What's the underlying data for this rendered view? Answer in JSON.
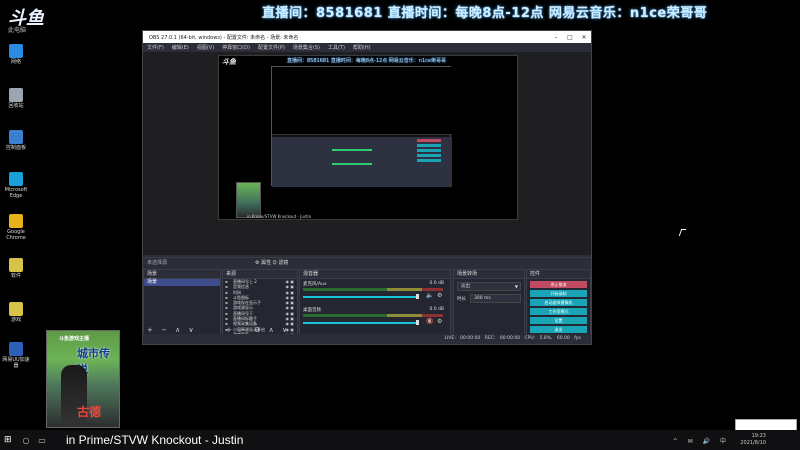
{
  "banner": "直播间：8581681 直播时间：每晚8点-12点 网易云音乐：n1ce荣哥哥",
  "logo": {
    "main": "斗鱼",
    "sub": "此电脑"
  },
  "desktop_icons": [
    {
      "label": "网络",
      "color": "#2b8be0"
    },
    {
      "label": "回收站",
      "color": "#9aa6b2"
    },
    {
      "label": "控制面板",
      "color": "#3a7fd0"
    },
    {
      "label": "Microsoft Edge",
      "color": "#19a0d8"
    },
    {
      "label": "Google Chrome",
      "color": "#e8b21a"
    },
    {
      "label": "软件",
      "color": "#d8c24a"
    },
    {
      "label": "游戏",
      "color": "#d8c24a"
    },
    {
      "label": "网易UU加速器",
      "color": "#2b5fb8"
    }
  ],
  "obs": {
    "title": "OBS 27.0.1 (64-bit, windows) - 配置文件: 未命名 - 场景: 未命名",
    "menu": [
      "文件(F)",
      "编辑(E)",
      "视图(V)",
      "停靠窗口(D)",
      "配置文件(P)",
      "场景集合(S)",
      "工具(T)",
      "帮助(H)"
    ],
    "preview": {
      "mini_banner": "直播间：8581681 直播时间：每晚8点-12点 网易云音乐：n1ce荣哥哥",
      "mini_logo": "斗鱼",
      "bottom_label": "in Prime/STVW  Knockout - Justin"
    },
    "dock_title": "未选择源",
    "dock_controls": "⚙ 属性   ⛭ 滤镜",
    "scenes": {
      "title": "场景",
      "selected": "场景",
      "footer": "+ − ∧ ∨"
    },
    "sources": {
      "title": "来源",
      "items": [
        "直播间号上 2",
        "音频信息",
        "时间",
        "斗鱼图标",
        "游戏存在显示子",
        "游戏源显示",
        "直播间号下",
        "直播间标题子",
        "视频采集设备",
        "小窗声源显示开启",
        "游戏图表"
      ],
      "footer": "+ − ⚙ ∧ ∨"
    },
    "mixer": {
      "title": "混音器",
      "channels": [
        {
          "name": "麦克风/Aux",
          "db": "0.0 dB"
        },
        {
          "name": "桌面音频",
          "db": "0.0 dB"
        }
      ]
    },
    "transitions": {
      "title": "场景转场",
      "type": "淡出",
      "duration_label": "时长",
      "duration": "300 ms"
    },
    "controls": {
      "title": "控件",
      "buttons": [
        "停止推流",
        "开始录制",
        "启动虚拟摄像机",
        "工作室模式",
        "设置",
        "退出"
      ]
    },
    "status": "LIVE: 00:00:00   REC: 00:00:00   CPU: 5.8%, 60.00 fps"
  },
  "overlay": {
    "top_text": "斗鱼游戏主播",
    "big_text": "城市传说",
    "name": "古德"
  },
  "ticker": "in Prime/STVW  Knockout - Justin",
  "clock": {
    "time": "19:23",
    "date": "2021/8/10"
  },
  "tray_icons": "^ ✉ 🔊 中"
}
